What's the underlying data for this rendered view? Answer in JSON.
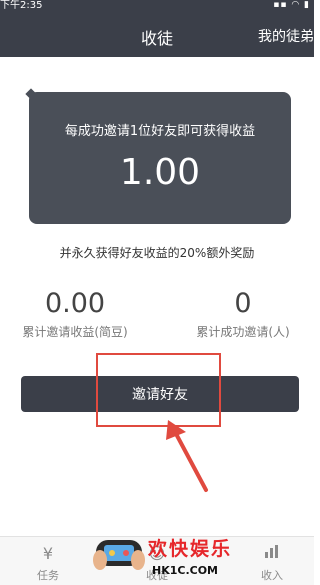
{
  "status_bar": {
    "time": "下午2:35"
  },
  "nav": {
    "title": "收徒",
    "right_link": "我的徒弟"
  },
  "card": {
    "description": "每成功邀请1位好友即可获得收益",
    "amount": "1.00"
  },
  "bonus_text": "并永久获得好友收益的20%额外奖励",
  "stats": {
    "earnings": {
      "value": "0.00",
      "label": "累计邀请收益(简豆)"
    },
    "invites": {
      "value": "0",
      "label": "累计成功邀请(人)"
    }
  },
  "invite_button": "邀请好友",
  "tabs": [
    {
      "label": "任务",
      "icon": "yen-coin-icon"
    },
    {
      "label": "收徒",
      "icon": "apprentice-icon"
    },
    {
      "label": "收入",
      "icon": "bar-chart-icon"
    }
  ],
  "watermark": {
    "text": "欢快娱乐",
    "site": "HK1C.COM"
  },
  "colors": {
    "dark": "#3b3f49",
    "card": "#4a4f58",
    "annotation": "#e04a3f"
  }
}
